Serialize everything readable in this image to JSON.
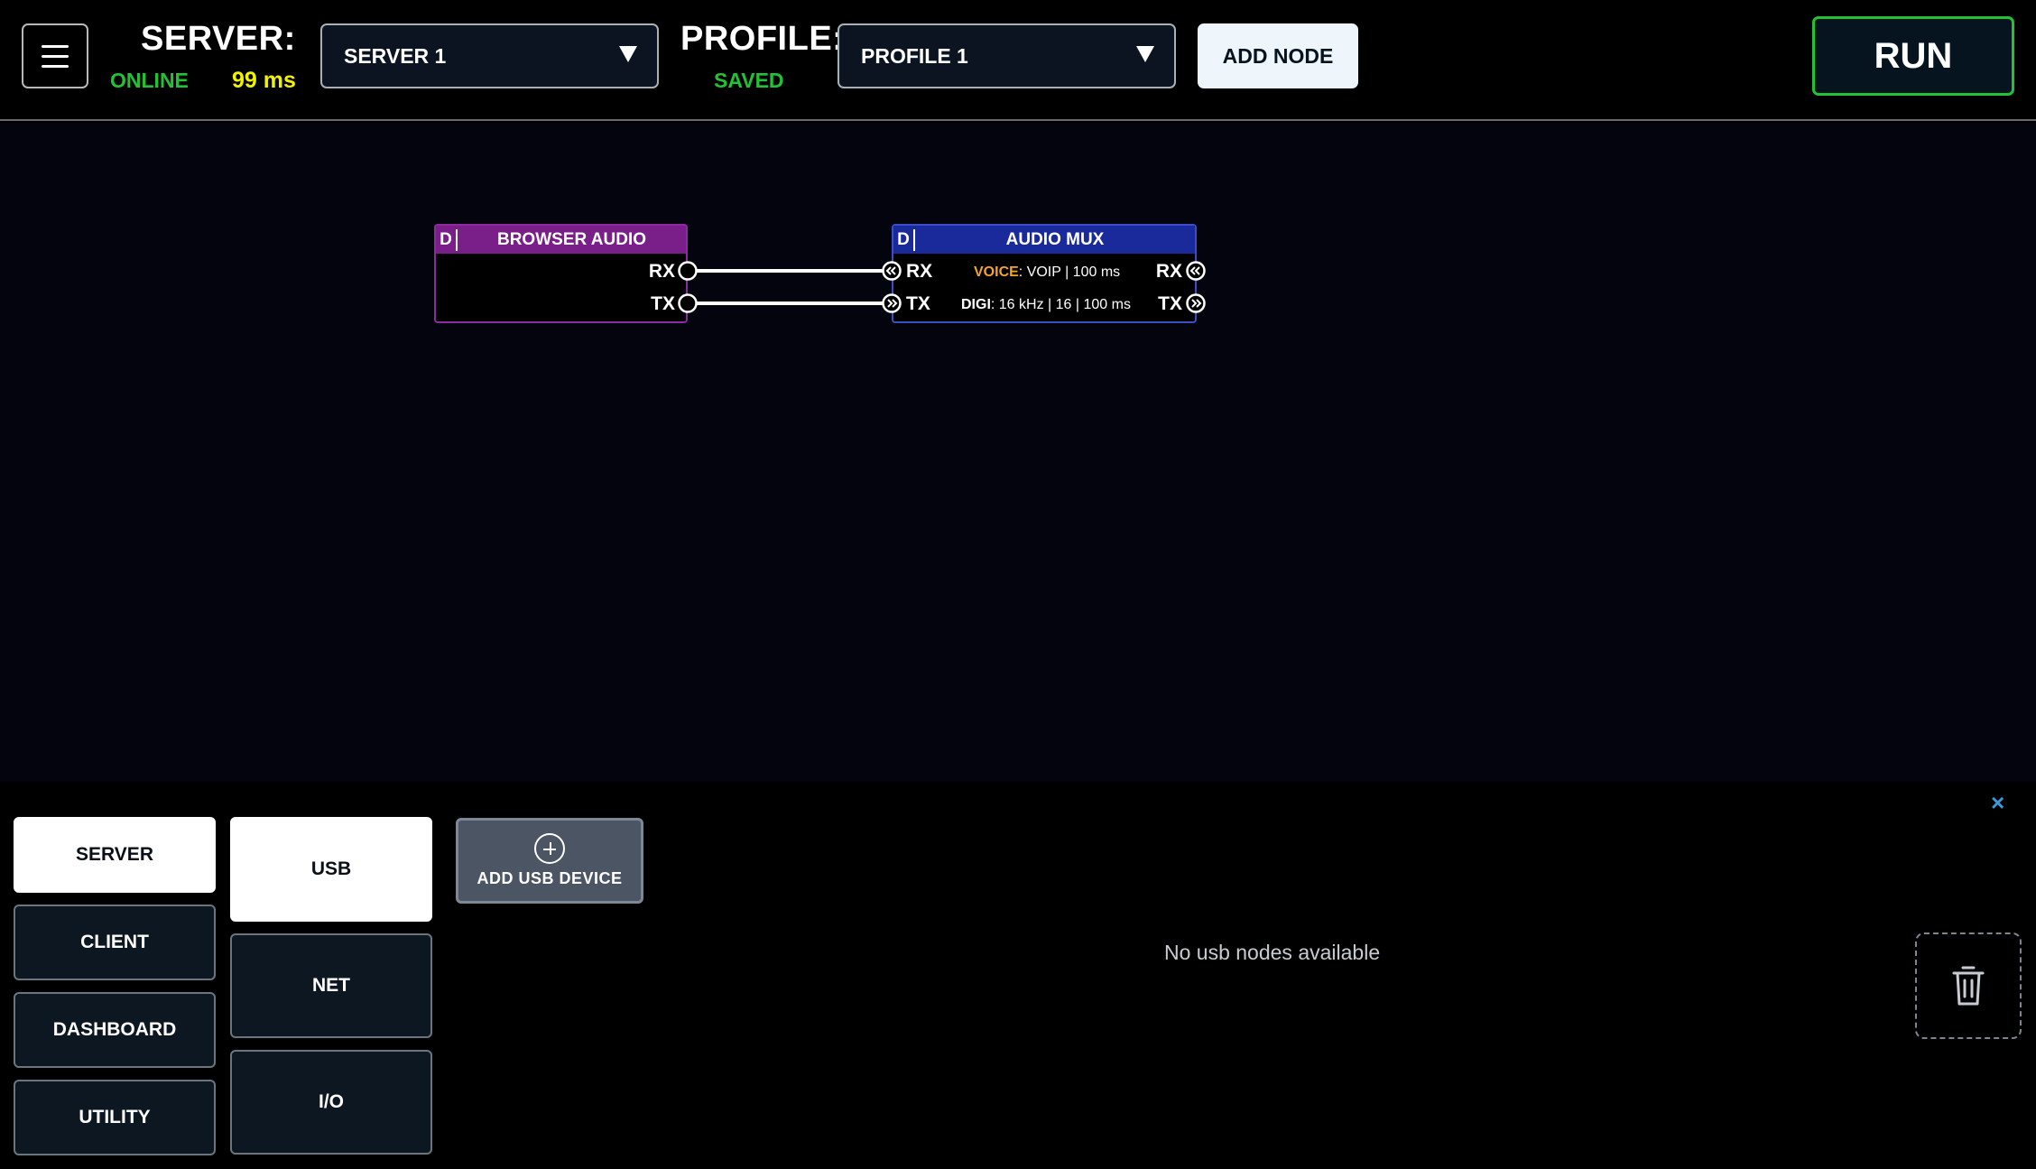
{
  "header": {
    "server_label": "SERVER:",
    "server_status": "ONLINE",
    "server_latency": "99 ms",
    "server_selected": "SERVER 1",
    "profile_label": "PROFILE:",
    "profile_status": "SAVED",
    "profile_selected": "PROFILE 1",
    "add_node_label": "ADD NODE",
    "run_label": "RUN"
  },
  "colors": {
    "online": "#22c234",
    "latency": "#f2f200",
    "saved": "#22c234",
    "browser_audio": "#7a1f8a",
    "audio_mux": "#1a2a9a",
    "voice_highlight": "#f5a623"
  },
  "nodes": {
    "browser_audio": {
      "flag": "D",
      "title": "BROWSER AUDIO",
      "ports": [
        "RX",
        "TX"
      ]
    },
    "audio_mux": {
      "flag": "D",
      "title": "AUDIO MUX",
      "in_ports": [
        "RX",
        "TX"
      ],
      "out_ports": [
        "RX",
        "TX"
      ],
      "voice_key": "VOICE",
      "voice_value": ": VOIP | 100 ms",
      "digi_key": "DIGI",
      "digi_value": ": 16 kHz | 16 | 100 ms"
    }
  },
  "panel": {
    "categories": [
      "SERVER",
      "CLIENT",
      "DASHBOARD",
      "UTILITY"
    ],
    "active_category": "SERVER",
    "subcategories": [
      "USB",
      "NET",
      "I/O"
    ],
    "active_subcategory": "USB",
    "add_device_label": "ADD USB DEVICE",
    "empty_message": "No usb nodes available",
    "close_glyph": "×"
  },
  "icons": {
    "menu": "hamburger-icon",
    "dropdown": "caret-down-icon",
    "add": "plus-circle-icon",
    "trash": "trash-icon",
    "close": "close-icon"
  }
}
